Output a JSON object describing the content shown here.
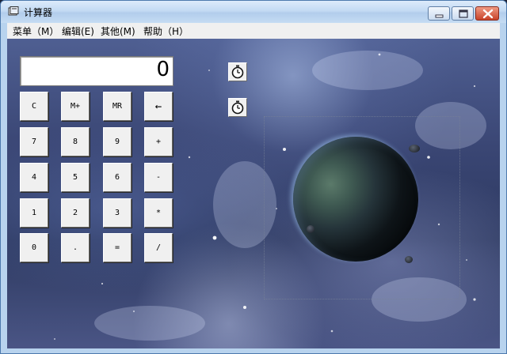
{
  "window": {
    "title": "计算器"
  },
  "menu": [
    {
      "label": "菜单（M）"
    },
    {
      "label": "编辑(E)"
    },
    {
      "label": "其他(M)"
    },
    {
      "label": "帮助（H）"
    }
  ],
  "display": {
    "value": "0"
  },
  "keys": {
    "row1": [
      "C",
      "M+",
      "MR",
      "←"
    ],
    "row2": [
      "7",
      "8",
      "9",
      "+"
    ],
    "row3": [
      "4",
      "5",
      "6",
      "-"
    ],
    "row4": [
      "1",
      "2",
      "3",
      "*"
    ],
    "row5": [
      "0",
      ".",
      "=",
      "/"
    ]
  },
  "icons": {
    "app": "calculator-window-icon",
    "timer": "stopwatch-icon",
    "minimize": "minimize-icon",
    "maximize": "maximize-icon",
    "close": "close-icon"
  },
  "colors": {
    "titlebar": "#c3daf3",
    "close_button": "#c8432a",
    "menubar": "#f0f0f0",
    "button_face": "#f0f0f0",
    "background": "#3a4674"
  }
}
